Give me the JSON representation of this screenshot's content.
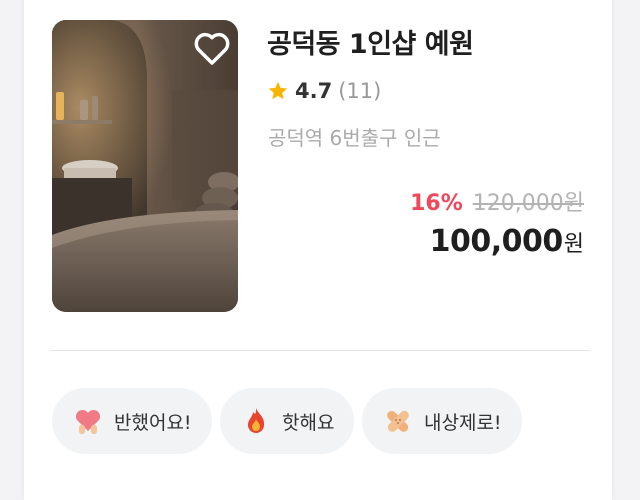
{
  "product": {
    "title": "공덕동 1인샵 예원",
    "rating": "4.7",
    "review_count": "(11)",
    "location": "공덕역 6번출구 인근",
    "discount": "16%",
    "original_price": "120,000원",
    "final_price": "100,000",
    "currency": "원"
  },
  "reactions": [
    {
      "label": "반했어요!",
      "icon": "heart-hands-icon"
    },
    {
      "label": "핫해요",
      "icon": "fire-icon"
    },
    {
      "label": "내상제로!",
      "icon": "bandage-icon"
    }
  ],
  "colors": {
    "discount": "#f0475b",
    "star": "#f7b500",
    "chip_bg": "#f2f3f5"
  }
}
